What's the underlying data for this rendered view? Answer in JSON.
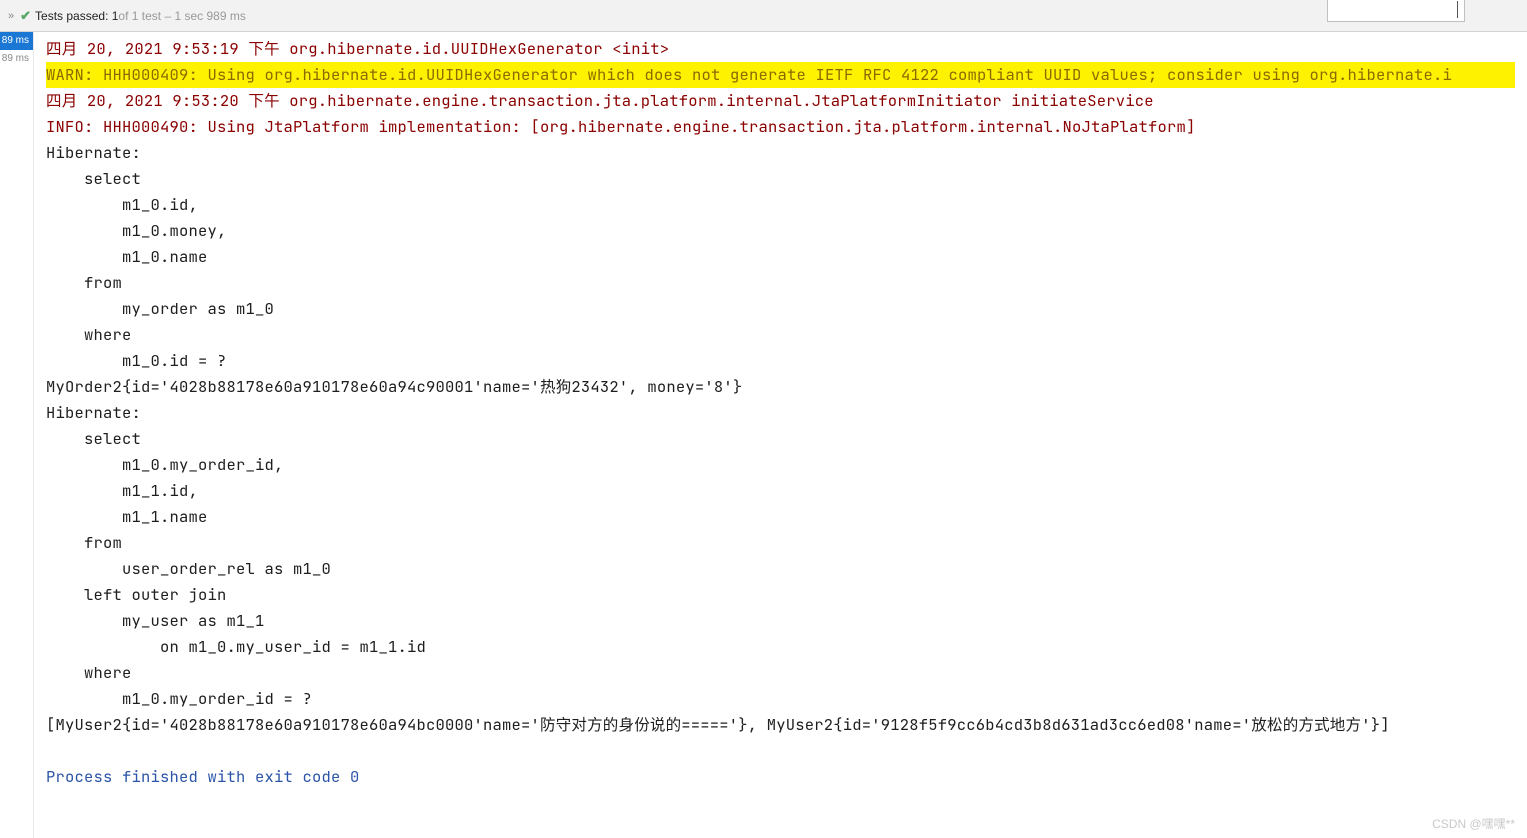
{
  "topBar": {
    "testsPassedLabel": "Tests passed: 1",
    "testsTotalLabel": " of 1 test – 1 sec 989 ms"
  },
  "sidebar": {
    "badge1": "89 ms",
    "badge2": "89 ms"
  },
  "console": {
    "lines": [
      {
        "style": "red",
        "text": "四月 20, 2021 9:53:19 下午 org.hibernate.id.UUIDHexGenerator <init>"
      },
      {
        "style": "warn",
        "text": "WARN: HHH000409: Using org.hibernate.id.UUIDHexGenerator which does not generate IETF RFC 4122 compliant UUID values; consider using org.hibernate.i"
      },
      {
        "style": "red",
        "text": "四月 20, 2021 9:53:20 下午 org.hibernate.engine.transaction.jta.platform.internal.JtaPlatformInitiator initiateService"
      },
      {
        "style": "red",
        "text": "INFO: HHH000490: Using JtaPlatform implementation: [org.hibernate.engine.transaction.jta.platform.internal.NoJtaPlatform]"
      },
      {
        "style": "black",
        "text": "Hibernate: "
      },
      {
        "style": "black",
        "text": "    select"
      },
      {
        "style": "black",
        "text": "        m1_0.id,"
      },
      {
        "style": "black",
        "text": "        m1_0.money,"
      },
      {
        "style": "black",
        "text": "        m1_0.name "
      },
      {
        "style": "black",
        "text": "    from"
      },
      {
        "style": "black",
        "text": "        my_order as m1_0 "
      },
      {
        "style": "black",
        "text": "    where"
      },
      {
        "style": "black",
        "text": "        m1_0.id = ?"
      },
      {
        "style": "black",
        "text": "MyOrder2{id='4028b88178e60a910178e60a94c90001'name='热狗23432', money='8'}"
      },
      {
        "style": "black",
        "text": "Hibernate: "
      },
      {
        "style": "black",
        "text": "    select"
      },
      {
        "style": "black",
        "text": "        m1_0.my_order_id,"
      },
      {
        "style": "black",
        "text": "        m1_1.id,"
      },
      {
        "style": "black",
        "text": "        m1_1.name "
      },
      {
        "style": "black",
        "text": "    from"
      },
      {
        "style": "black",
        "text": "        user_order_rel as m1_0 "
      },
      {
        "style": "black",
        "text": "    left outer join"
      },
      {
        "style": "black",
        "text": "        my_user as m1_1 "
      },
      {
        "style": "black",
        "text": "            on m1_0.my_user_id = m1_1.id "
      },
      {
        "style": "black",
        "text": "    where"
      },
      {
        "style": "black",
        "text": "        m1_0.my_order_id = ?"
      },
      {
        "style": "black",
        "text": "[MyUser2{id='4028b88178e60a910178e60a94bc0000'name='防守对方的身份说的====='}, MyUser2{id='9128f5f9cc6b4cd3b8d631ad3cc6ed08'name='放松的方式地方'}]"
      },
      {
        "style": "black",
        "text": ""
      },
      {
        "style": "blue",
        "text": "Process finished with exit code 0"
      }
    ]
  },
  "watermark": "CSDN @嘿嘿**"
}
